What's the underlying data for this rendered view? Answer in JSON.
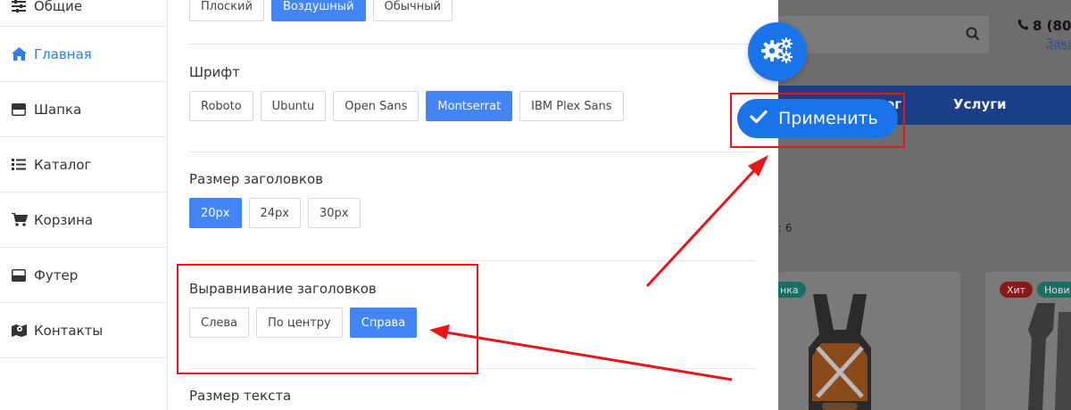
{
  "sidebar": {
    "items": [
      {
        "label": "Общие",
        "icon": "sliders-icon"
      },
      {
        "label": "Главная",
        "icon": "home-icon"
      },
      {
        "label": "Шапка",
        "icon": "header-icon"
      },
      {
        "label": "Каталог",
        "icon": "list-icon"
      },
      {
        "label": "Корзина",
        "icon": "cart-icon"
      },
      {
        "label": "Футер",
        "icon": "footer-icon"
      },
      {
        "label": "Контакты",
        "icon": "map-icon"
      }
    ],
    "active_index": 1
  },
  "panel": {
    "style_options": [
      "Плоский",
      "Воздушный",
      "Обычный"
    ],
    "style_selected": "Воздушный",
    "font": {
      "title": "Шрифт",
      "options": [
        "Roboto",
        "Ubuntu",
        "Open Sans",
        "Montserrat",
        "IBM Plex Sans"
      ],
      "selected": "Montserrat"
    },
    "heading_size": {
      "title": "Размер заголовков",
      "options": [
        "20px",
        "24px",
        "30px"
      ],
      "selected": "20px"
    },
    "heading_align": {
      "title": "Выравнивание заголовков",
      "options": [
        "Слева",
        "По центру",
        "Справа"
      ],
      "selected": "Справа"
    },
    "text_size": {
      "title": "Размер текста"
    }
  },
  "apply_button": {
    "label": "Применить"
  },
  "preview": {
    "phone": "8 (80",
    "order_link": "Зака",
    "nav_items": [
      "ог",
      "Услуги"
    ],
    "count_text": ": 6",
    "badges": [
      "нка",
      "Хит",
      "Нови"
    ]
  },
  "colors": {
    "accent": "#4385f5",
    "fab": "#1a73e8",
    "annotation": "#e8151b",
    "navbar": "#1a3f86"
  }
}
